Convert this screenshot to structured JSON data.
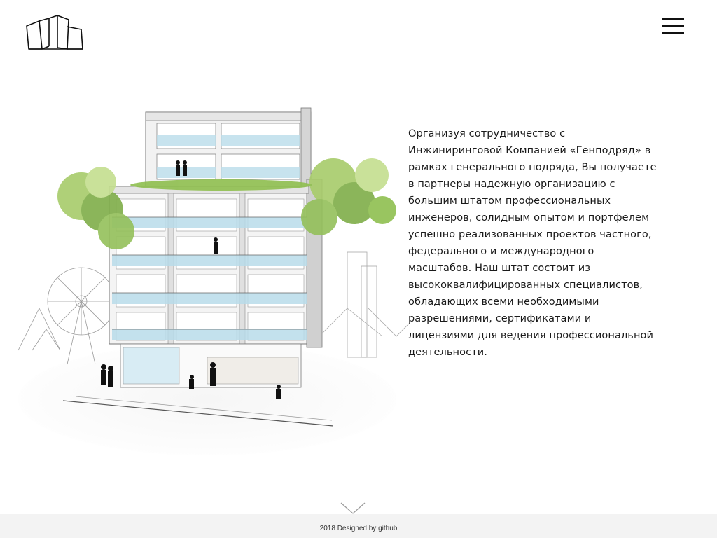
{
  "header": {
    "logo_icon": "building-outline-logo",
    "menu_icon": "hamburger-menu-icon"
  },
  "main": {
    "illustration_icon": "building-sketch-illustration",
    "description": "Организуя сотрудничество с Инжиниринговой Компанией «Генподряд» в рамках генерального подряда, Вы получаете в партнеры надежную организацию с большим штатом профессиональных инженеров, солидным опытом и портфелем успешно реализованных проектов частного, федерального и международного масштабов. Наш штат состоит из высококвалифицированных специалистов, обладающих всеми необходимыми разрешениями, сертификатами и лицензиями для ведения профессиональной деятельности.",
    "scroll_icon": "chevron-down-icon"
  },
  "footer": {
    "text": "2018 Designed by github"
  },
  "colors": {
    "background": "#ffffff",
    "footer_bg": "#f3f3f3",
    "text": "#1a1a1a",
    "balcony_glass": "#b9dcea",
    "foliage": "#8fbf4f"
  }
}
